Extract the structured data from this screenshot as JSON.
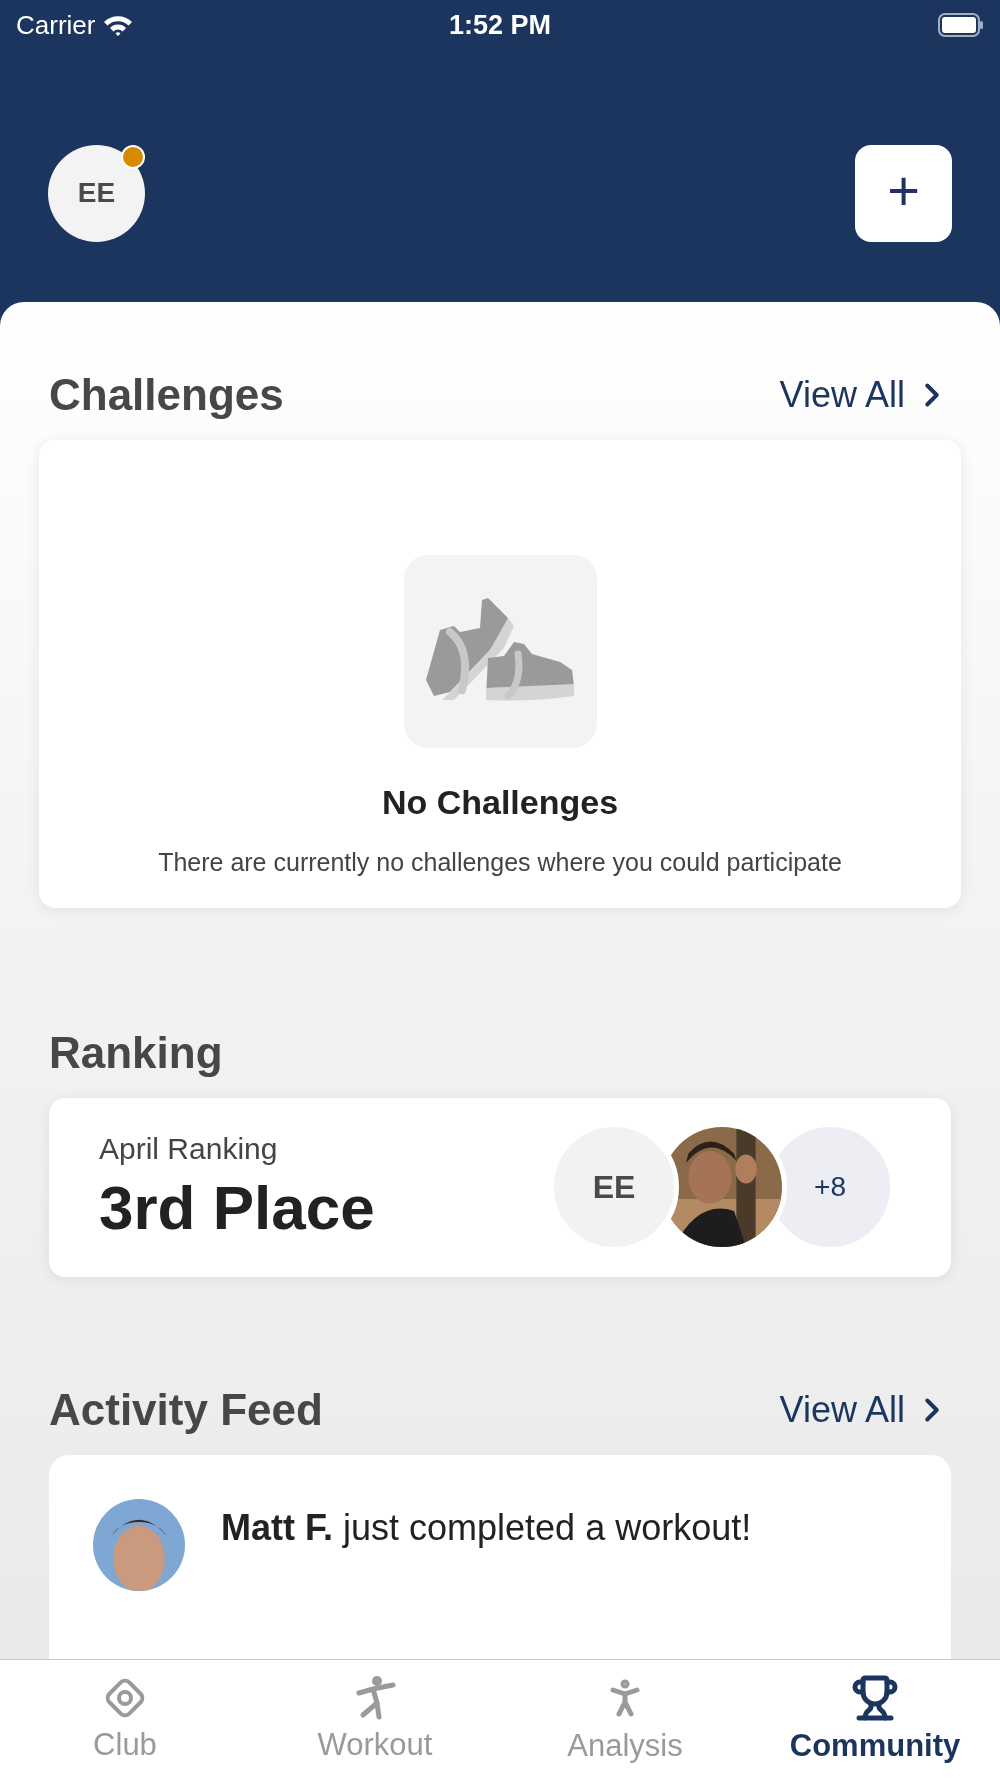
{
  "status_bar": {
    "carrier": "Carrier",
    "time": "1:52 PM"
  },
  "header": {
    "avatar_initials": "EE",
    "has_notification": true,
    "add_button": "+"
  },
  "challenges": {
    "title": "Challenges",
    "view_all": "View All",
    "empty_title": "No Challenges",
    "empty_text": "There are currently no challenges where you could participate"
  },
  "ranking": {
    "title": "Ranking",
    "period": "April Ranking",
    "place": "3rd Place",
    "avatars": [
      {
        "kind": "initials",
        "text": "EE"
      },
      {
        "kind": "picture"
      },
      {
        "kind": "count",
        "text": "+8"
      }
    ]
  },
  "activity_feed": {
    "title": "Activity Feed",
    "view_all": "View All",
    "items": [
      {
        "name": "Matt F.",
        "text": "just completed a workout!"
      }
    ]
  },
  "tabs": [
    {
      "label": "Club",
      "selected": false
    },
    {
      "label": "Workout",
      "selected": false
    },
    {
      "label": "Analysis",
      "selected": false
    },
    {
      "label": "Community",
      "selected": true
    }
  ]
}
